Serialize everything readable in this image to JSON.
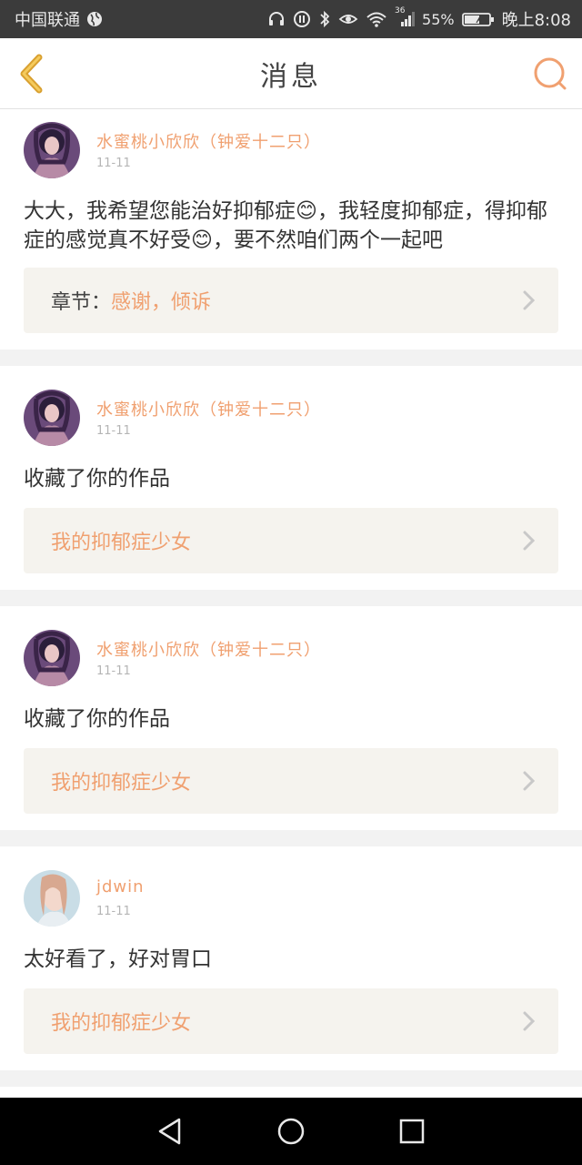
{
  "status_bar": {
    "carrier": "中国联通",
    "network": "36",
    "battery": "55%",
    "time": "晚上8:08"
  },
  "header": {
    "title": "消息"
  },
  "messages": [
    {
      "username": "水蜜桃小欣欣（钟爱十二只）",
      "time": "11-11",
      "content": "大大，我希望您能治好抑郁症😊，我轻度抑郁症，得抑郁症的感觉真不好受😊，要不然咱们两个一起吧",
      "link_prefix": "章节：",
      "link_text": "感谢，倾诉"
    },
    {
      "username": "水蜜桃小欣欣（钟爱十二只）",
      "time": "11-11",
      "content": "收藏了你的作品",
      "link_prefix": "",
      "link_text": "我的抑郁症少女"
    },
    {
      "username": "水蜜桃小欣欣（钟爱十二只）",
      "time": "11-11",
      "content": "收藏了你的作品",
      "link_prefix": "",
      "link_text": "我的抑郁症少女"
    },
    {
      "username": "jdwin",
      "time": "11-11",
      "content": "太好看了，好对胃口",
      "link_prefix": "",
      "link_text": "我的抑郁症少女"
    }
  ],
  "colors": {
    "accent": "#f0a070",
    "back_arrow": "#f0b840",
    "status_bar": "#3b3b3b",
    "link_box": "#f5f3ee"
  }
}
